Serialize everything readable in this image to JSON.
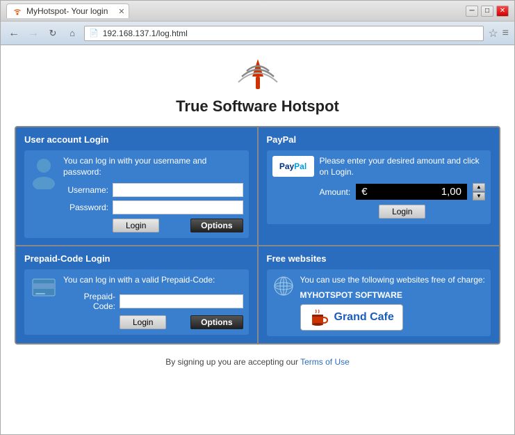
{
  "browser": {
    "title": "MyHotspot- Your login",
    "url": "192.168.137.1/log.html",
    "back_disabled": false,
    "forward_disabled": true
  },
  "page": {
    "title": "True Software Hotspot",
    "footer_text": "By signing up you are accepting our ",
    "footer_link": "Terms of Use"
  },
  "user_panel": {
    "header": "User account Login",
    "description": "You can log in with  your username  and password:",
    "username_label": "Username:",
    "password_label": "Password:",
    "login_btn": "Login",
    "options_btn": "Options"
  },
  "paypal_panel": {
    "header": "PayPal",
    "description": "Please enter your desired amount and click on Login.",
    "amount_label": "Amount:",
    "currency_symbol": "€",
    "amount_value": "1,00",
    "login_btn": "Login"
  },
  "prepaid_panel": {
    "header": "Prepaid-Code Login",
    "description": "You can log in with a valid Prepaid-Code:",
    "code_label": "Prepaid-Code:",
    "login_btn": "Login",
    "options_btn": "Options"
  },
  "free_panel": {
    "header": "Free websites",
    "description": "You can use the  following websites  free of charge:",
    "software_label": "MYHOTSPOT SOFTWARE",
    "grand_cafe_label": "Grand Cafe"
  }
}
